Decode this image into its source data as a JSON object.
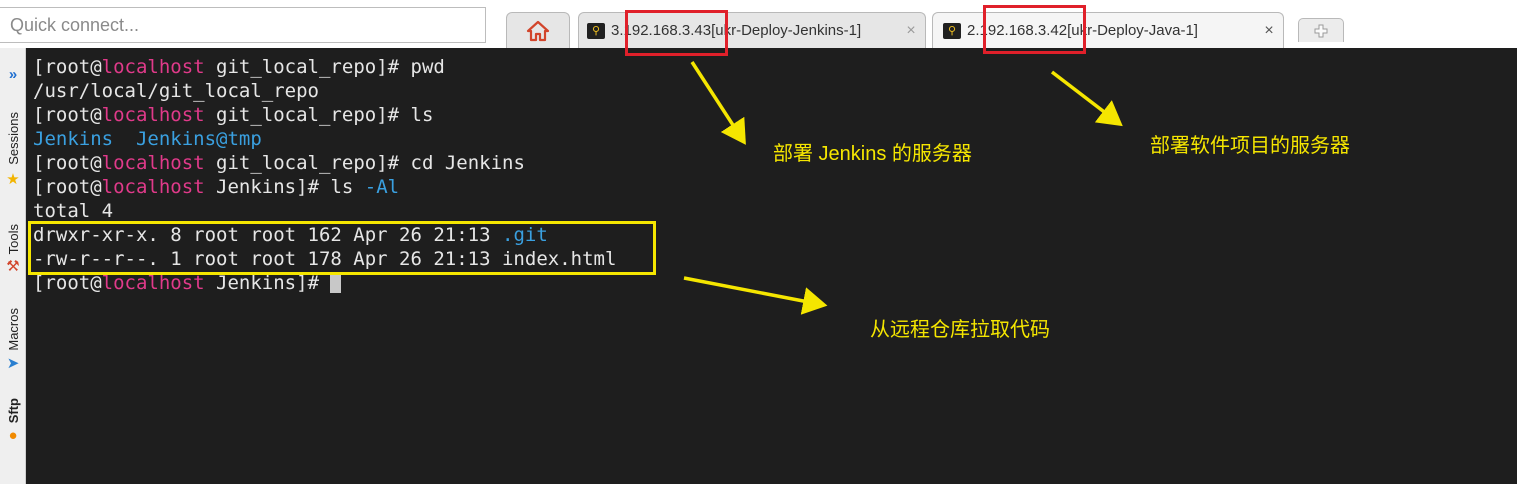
{
  "quick_connect": {
    "placeholder": "Quick connect..."
  },
  "tabs": [
    {
      "icon": "home-icon"
    },
    {
      "icon": "key-icon",
      "title": "3.192.168.3.43[ukr-Deploy-Jenkins-1]",
      "close": "×"
    },
    {
      "icon": "key-icon",
      "title": "2.192.168.3.42[ukr-Deploy-Java-1]",
      "close": "×",
      "active": true
    },
    {
      "icon": "new-tab-icon"
    }
  ],
  "sidebar": {
    "items": [
      {
        "label": "Sessions",
        "icon": "double-chevron-icon"
      },
      {
        "label": "Tools",
        "icon": "star-icon"
      },
      {
        "label": "Macros",
        "icon": "tools-icon"
      },
      {
        "label": "Sftp",
        "icon": "send-icon"
      }
    ]
  },
  "terminal": {
    "prompt_user": "[root@",
    "host": "localhost",
    "lines": [
      {
        "dir": "git_local_repo",
        "cmd": "pwd"
      },
      {
        "output": "/usr/local/git_local_repo"
      },
      {
        "dir": "git_local_repo",
        "cmd": "ls"
      },
      {
        "output_colored": "Jenkins  Jenkins@tmp"
      },
      {
        "dir": "git_local_repo",
        "cmd": "cd Jenkins"
      },
      {
        "dir": "Jenkins",
        "cmd": "ls ",
        "cmd_colored": "-Al"
      },
      {
        "output": "total 4"
      },
      {
        "output": "drwxr-xr-x. 8 root root 162 Apr 26 21:13 ",
        "output_colored": ".git"
      },
      {
        "output": "-rw-r--r--. 1 root root 178 Apr 26 21:13 index.html"
      },
      {
        "dir": "Jenkins",
        "cmd": ""
      }
    ]
  },
  "annotations": {
    "note_jenkins_server": "部署 Jenkins 的服务器",
    "note_project_server": "部署软件项目的服务器",
    "note_pull_code": "从远程仓库拉取代码",
    "highlight_color": "#f5e600",
    "box_color": "#e0202a"
  }
}
